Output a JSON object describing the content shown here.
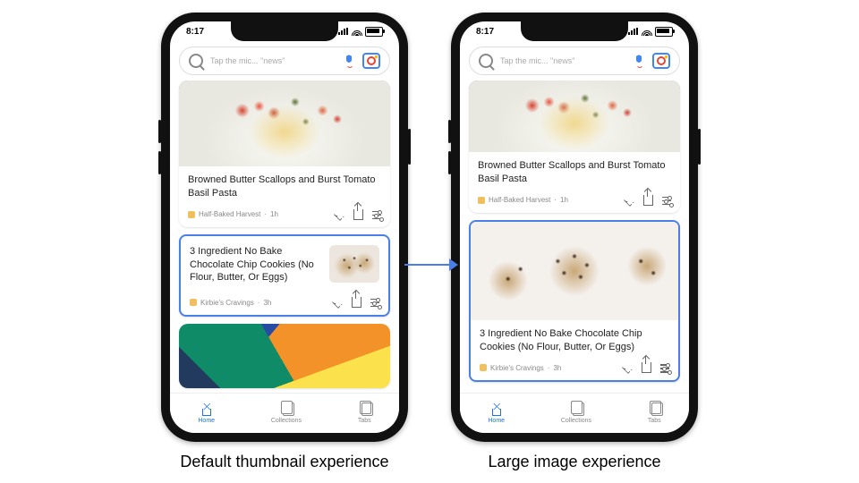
{
  "statusbar": {
    "time": "8:17"
  },
  "search": {
    "placeholder": "Tap the mic... \"news\""
  },
  "cards": {
    "pasta": {
      "title": "Browned Butter Scallops and Burst Tomato Basil Pasta",
      "source": "Half-Baked Harvest",
      "age": "1h"
    },
    "cookies": {
      "title": "3 Ingredient No Bake Chocolate Chip Cookies (No Flour, Butter, Or Eggs)",
      "source": "Kirbie's Cravings",
      "age": "3h"
    }
  },
  "tabs": {
    "home": "Home",
    "collections": "Collections",
    "tabsLabel": "Tabs"
  },
  "captions": {
    "left": "Default thumbnail experience",
    "right": "Large image experience"
  }
}
